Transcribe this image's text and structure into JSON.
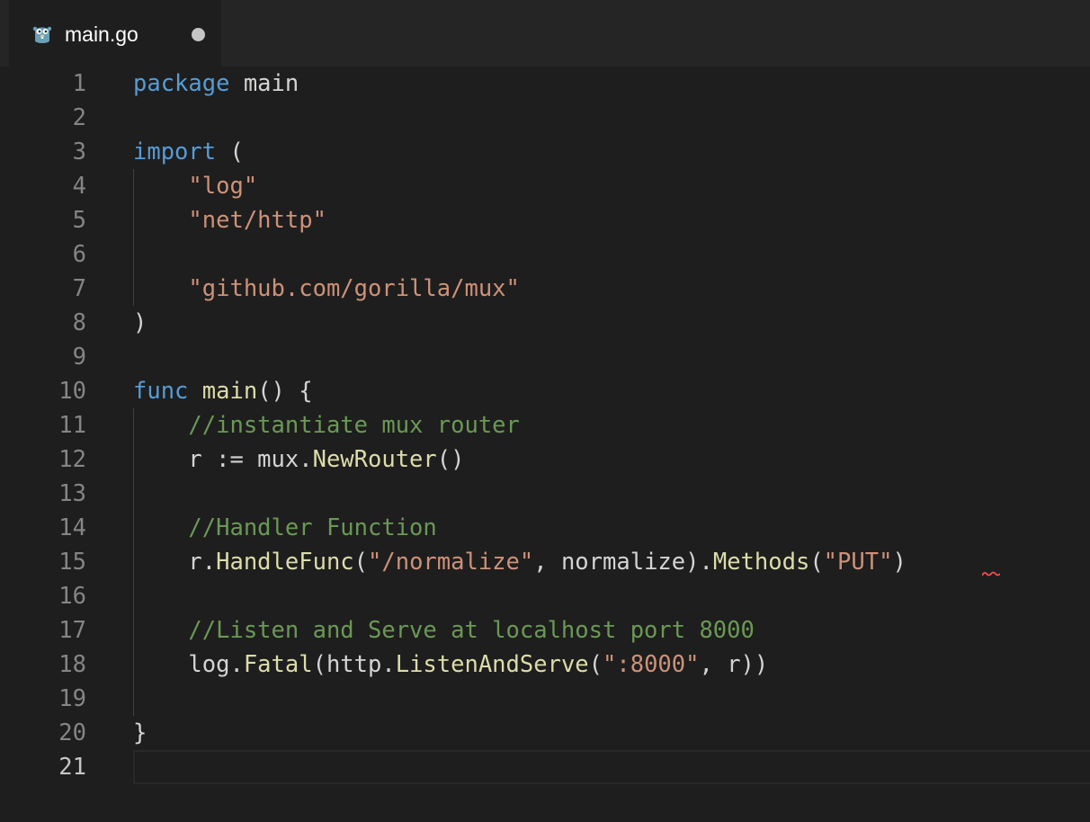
{
  "tab": {
    "title": "main.go",
    "icon": "gopher-icon",
    "modified": true
  },
  "colors": {
    "background": "#1e1e1e",
    "keyword": "#569cd6",
    "string": "#ce9178",
    "function": "#dcdcaa",
    "comment": "#6a9955",
    "text": "#d4d4d4",
    "line_number": "#858585"
  },
  "editor": {
    "active_line": 21,
    "line_numbers": [
      "1",
      "2",
      "3",
      "4",
      "5",
      "6",
      "7",
      "8",
      "9",
      "10",
      "11",
      "12",
      "13",
      "14",
      "15",
      "16",
      "17",
      "18",
      "19",
      "20",
      "21"
    ],
    "lines": [
      [
        {
          "t": "package",
          "c": "kw"
        },
        {
          "t": " main",
          "c": "pl"
        }
      ],
      [],
      [
        {
          "t": "import",
          "c": "kw"
        },
        {
          "t": " (",
          "c": "pl"
        }
      ],
      [
        {
          "t": "    ",
          "c": "pl"
        },
        {
          "t": "\"log\"",
          "c": "str"
        }
      ],
      [
        {
          "t": "    ",
          "c": "pl"
        },
        {
          "t": "\"net/http\"",
          "c": "str"
        }
      ],
      [],
      [
        {
          "t": "    ",
          "c": "pl"
        },
        {
          "t": "\"github.com/gorilla/mux\"",
          "c": "str"
        }
      ],
      [
        {
          "t": ")",
          "c": "pl"
        }
      ],
      [],
      [
        {
          "t": "func",
          "c": "kw"
        },
        {
          "t": " ",
          "c": "pl"
        },
        {
          "t": "main",
          "c": "fn"
        },
        {
          "t": "() {",
          "c": "pl"
        }
      ],
      [
        {
          "t": "    ",
          "c": "pl"
        },
        {
          "t": "//instantiate mux router",
          "c": "cm"
        }
      ],
      [
        {
          "t": "    r := mux.",
          "c": "pl"
        },
        {
          "t": "NewRouter",
          "c": "fn"
        },
        {
          "t": "()",
          "c": "pl"
        }
      ],
      [],
      [
        {
          "t": "    ",
          "c": "pl"
        },
        {
          "t": "//Handler Function",
          "c": "cm"
        }
      ],
      [
        {
          "t": "    r.",
          "c": "pl"
        },
        {
          "t": "HandleFunc",
          "c": "fn"
        },
        {
          "t": "(",
          "c": "pl"
        },
        {
          "t": "\"/normalize\"",
          "c": "str"
        },
        {
          "t": ", normalize).",
          "c": "pl"
        },
        {
          "t": "Methods",
          "c": "fn"
        },
        {
          "t": "(",
          "c": "pl"
        },
        {
          "t": "\"PUT\"",
          "c": "str"
        },
        {
          "t": ")",
          "c": "pl"
        }
      ],
      [],
      [
        {
          "t": "    ",
          "c": "pl"
        },
        {
          "t": "//Listen and Serve at localhost port 8000",
          "c": "cm"
        }
      ],
      [
        {
          "t": "    log.",
          "c": "pl"
        },
        {
          "t": "Fatal",
          "c": "fn"
        },
        {
          "t": "(http.",
          "c": "pl"
        },
        {
          "t": "ListenAndServe",
          "c": "fn"
        },
        {
          "t": "(",
          "c": "pl"
        },
        {
          "t": "\":8000\"",
          "c": "str"
        },
        {
          "t": ", r))",
          "c": "pl"
        }
      ],
      [],
      [
        {
          "t": "}",
          "c": "pl"
        }
      ],
      []
    ]
  }
}
